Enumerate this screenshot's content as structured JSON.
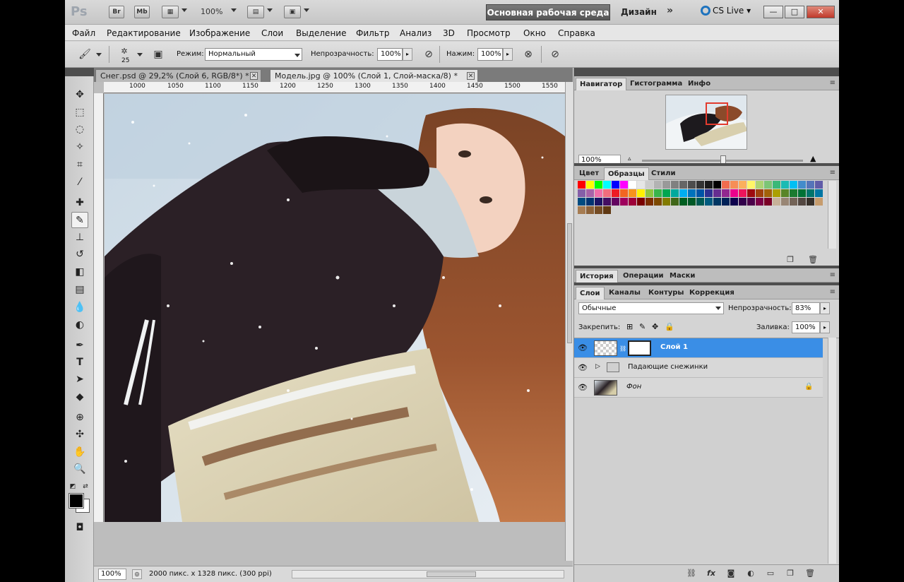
{
  "app": {
    "logo": "Ps",
    "bridge_btn": "Br",
    "minibridge_btn": "Mb",
    "zoom_level": "100%",
    "workspace_active": "Основная рабочая среда",
    "workspace_design": "Дизайн",
    "more": "»",
    "cs_live": "CS Live",
    "win_min": "—",
    "win_max": "□",
    "win_close": "✕"
  },
  "menu": [
    "Файл",
    "Редактирование",
    "Изображение",
    "Слои",
    "Выделение",
    "Фильтр",
    "Анализ",
    "3D",
    "Просмотр",
    "Окно",
    "Справка"
  ],
  "options": {
    "brush_size": "25",
    "mode_label": "Режим:",
    "mode_value": "Нормальный",
    "opacity_label": "Непрозрачность:",
    "opacity_value": "100%",
    "pressure_label": "Нажим:",
    "pressure_value": "100%"
  },
  "doc_tabs": [
    {
      "label": "Снег.psd @ 29,2% (Слой 6, RGB/8*) *",
      "active": false
    },
    {
      "label": "Модель.jpg @ 100% (Слой 1, Слой-маска/8) *",
      "active": true
    }
  ],
  "ruler_labels": [
    "1000",
    "1050",
    "1100",
    "1150",
    "1200",
    "1250",
    "1300",
    "1350",
    "1400",
    "1450",
    "1500",
    "1550"
  ],
  "status": {
    "zoom": "100%",
    "info": "2000 пикс. x 1328 пикс. (300 ppi)"
  },
  "navigator": {
    "tabs": [
      "Навигатор",
      "Гистограмма",
      "Инфо"
    ],
    "zoom": "100%"
  },
  "swatches_panel": {
    "tabs": [
      "Цвет",
      "Образцы",
      "Стили"
    ],
    "colors": [
      "#ff0000",
      "#ffff00",
      "#00ff00",
      "#00ffff",
      "#0000ff",
      "#ff00ff",
      "#ffffff",
      "#e6e6e6",
      "#cccccc",
      "#b3b3b3",
      "#999999",
      "#808080",
      "#666666",
      "#4d4d4d",
      "#333333",
      "#1a1a1a",
      "#000000",
      "#f26c4f",
      "#f68e56",
      "#fbaf5d",
      "#fff568",
      "#acd373",
      "#7cc576",
      "#3bb878",
      "#1abbb4",
      "#00bff3",
      "#438ccb",
      "#5574b9",
      "#605ca8",
      "#855fa8",
      "#a763a8",
      "#f06ea9",
      "#f26d7d",
      "#ed1c24",
      "#f26522",
      "#f7941d",
      "#fff200",
      "#8dc63f",
      "#39b54a",
      "#00a651",
      "#00a99d",
      "#00aeef",
      "#0072bc",
      "#0054a6",
      "#2e3192",
      "#662d91",
      "#92278f",
      "#ec008c",
      "#ed145b",
      "#9e0b0f",
      "#a0410d",
      "#a36209",
      "#aba000",
      "#598527",
      "#1a7b30",
      "#007236",
      "#00746b",
      "#0076a3",
      "#004b80",
      "#003471",
      "#1b1464",
      "#440e62",
      "#630460",
      "#9e005d",
      "#9e0039",
      "#790000",
      "#7b2e00",
      "#7d4900",
      "#827b00",
      "#406618",
      "#005e20",
      "#005826",
      "#005952",
      "#005b7f",
      "#003663",
      "#002157",
      "#0d004c",
      "#32004b",
      "#4b0049",
      "#7b0046",
      "#7a0026",
      "#c7b299",
      "#998675",
      "#736357",
      "#534741",
      "#37302a",
      "#c69c6d",
      "#a67c52",
      "#8c6239",
      "#754c24",
      "#603913"
    ]
  },
  "layers_panel": {
    "top_tabs": [
      "История",
      "Операции",
      "Маски"
    ],
    "tabs": [
      "Слои",
      "Каналы",
      "Контуры",
      "Коррекция"
    ],
    "blend_mode": "Обычные",
    "opacity_label": "Непрозрачность:",
    "opacity_value": "83%",
    "lock_label": "Закрепить:",
    "fill_label": "Заливка:",
    "fill_value": "100%",
    "layers": [
      {
        "name": "Слой 1",
        "selected": true
      },
      {
        "name": "Падающие снежинки",
        "selected": false
      },
      {
        "name": "Фон",
        "selected": false
      }
    ]
  },
  "colors": {
    "accent_selected": "#3a8ee6",
    "workspace_btn": "#5f5f5f"
  }
}
